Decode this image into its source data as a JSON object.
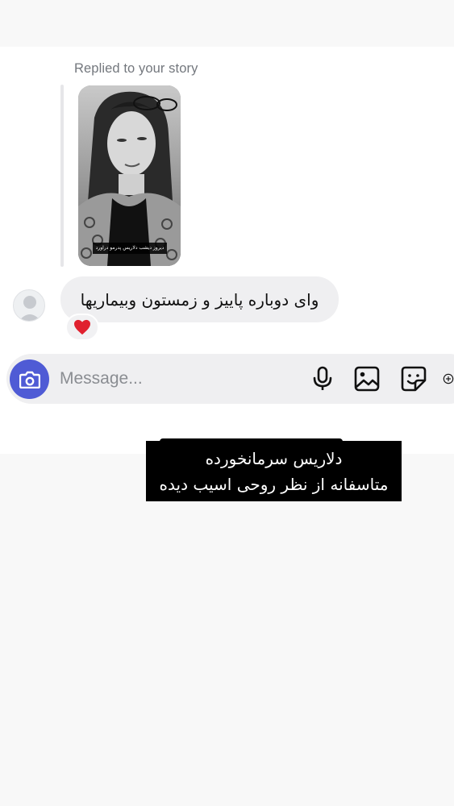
{
  "story_reply": {
    "label": "Replied to your story",
    "story_caption": "دیروز دیشب دلاریس پدرمو دراورد"
  },
  "message": {
    "text": "وای دوباره پاییز و زمستون وبیماریها",
    "reaction": "❤️"
  },
  "composer": {
    "placeholder": "Message...",
    "icons": [
      "camera-icon",
      "microphone-icon",
      "gallery-icon",
      "sticker-icon",
      "add-icon"
    ],
    "camera_color": "#4f5bd5"
  },
  "subtitle": {
    "line1": "دلاریس سرمانخورده",
    "line2": "متاسفانه از نظر روحی اسیب دیده"
  }
}
